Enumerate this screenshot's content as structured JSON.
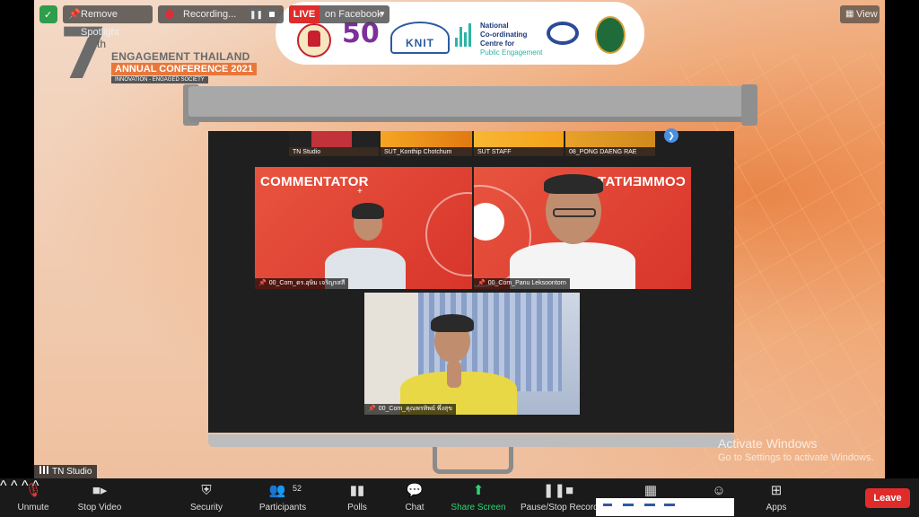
{
  "toolbar": {
    "spotlight_label": "Remove Spotlight",
    "recording_label": "Recording...",
    "live_badge": "LIVE",
    "live_label": "on Facebook",
    "view_label": "View"
  },
  "conference": {
    "number": "7",
    "suffix": "th",
    "title": "ENGAGEMENT THAILAND",
    "subtitle": "ANNUAL CONFERENCE 2021",
    "tagline": "INNOVATION - ENGAGED SOCIETY"
  },
  "partners": {
    "knit": "KNIT",
    "nccpe_line1": "National",
    "nccpe_line2": "Co-ordinating",
    "nccpe_line3": "Centre for",
    "nccpe_line4": "Public Engagement",
    "fifty": "50"
  },
  "thumbnails": [
    {
      "name": "TN Studio"
    },
    {
      "name": "SUT_Konthip Chotchum"
    },
    {
      "name": "SUT STAFF"
    },
    {
      "name": "08_PONG DAENG RAE"
    }
  ],
  "tiles": {
    "left_title": "COMMENTATOR",
    "left_name": "00_Com_ดร.อุษิม เจริญรสสี",
    "right_title": "COMMENTATOR",
    "right_name": "00_Com_Panu Leksoontorn",
    "bottom_name": "00_Com_คุณพรทิพย์ พึ่งสุข"
  },
  "watermark": {
    "line1": "Activate Windows",
    "line2": "Go to Settings to activate Windows."
  },
  "active_speaker": "TN Studio",
  "bottom_bar": {
    "unmute": "Unmute",
    "stop_video": "Stop Video",
    "security": "Security",
    "participants": "Participants",
    "participants_count": "52",
    "polls": "Polls",
    "chat": "Chat",
    "share_screen": "Share Screen",
    "pause_stop": "Pause/Stop Recording",
    "apps": "Apps",
    "leave": "Leave"
  },
  "colors": {
    "live": "#e02b2b",
    "share": "#2ed573",
    "leave": "#e02b2b",
    "commentator_bg": "#e8543f"
  }
}
